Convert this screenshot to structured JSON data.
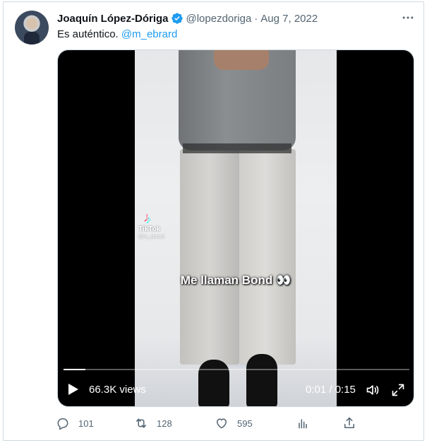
{
  "tweet": {
    "author_name": "Joaquín López-Dóriga",
    "author_handle": "@lopezdoriga",
    "separator": "·",
    "date": "Aug 7, 2022",
    "text_prefix": "Es auténtico.",
    "mention": "@m_ebrard"
  },
  "video": {
    "tiktok_brand": "TikTok",
    "tiktok_user": "@m_ebrard",
    "caption": "Me llaman Bond 👀",
    "views": "66.3K views",
    "time": "0:01 / 0:15",
    "progress_fraction": 0.063
  },
  "actions": {
    "replies": "101",
    "retweets": "128",
    "likes": "595"
  },
  "icons": {
    "verified": "verified-badge-icon",
    "more": "more-icon",
    "play": "play-icon",
    "volume": "volume-icon",
    "fullscreen": "fullscreen-icon",
    "reply": "reply-icon",
    "retweet": "retweet-icon",
    "like": "like-icon",
    "analytics": "analytics-icon",
    "share": "share-icon"
  },
  "colors": {
    "accent": "#1d9bf0",
    "secondary_text": "#536471"
  }
}
